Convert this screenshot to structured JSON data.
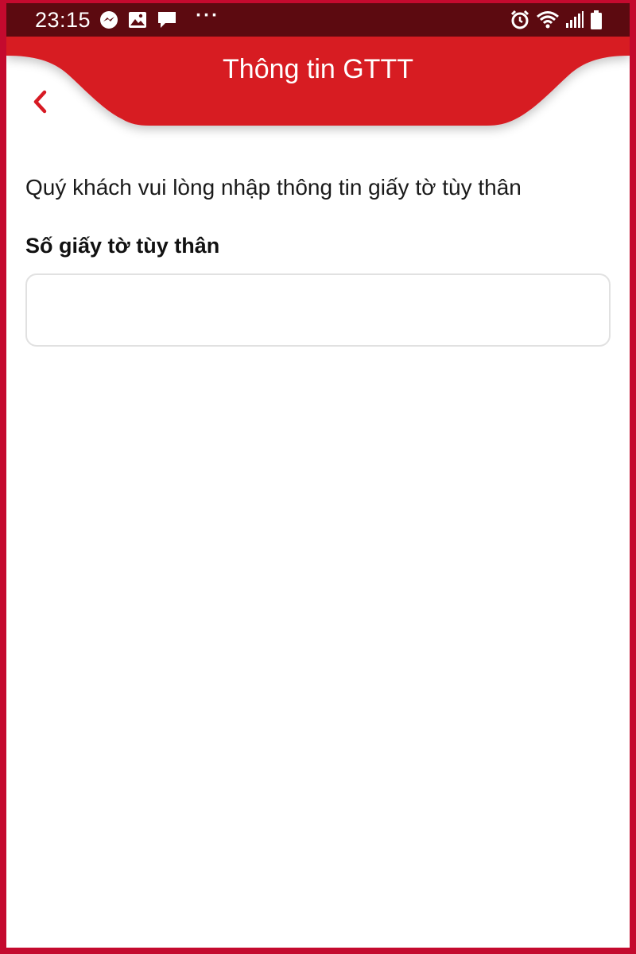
{
  "status_bar": {
    "time": "23:15",
    "left_icons": [
      "messenger-icon",
      "gallery-icon",
      "chat-bubble-icon"
    ],
    "more_indicator": "···",
    "right_icons": [
      "alarm-icon",
      "wifi-icon",
      "signal-icon",
      "battery-icon"
    ]
  },
  "header": {
    "title": "Thông tin GTTT",
    "back_icon": "chevron-left-icon",
    "accent_color": "#d71a24"
  },
  "form": {
    "instruction": "Quý khách vui lòng nhập thông tin giấy tờ tùy thân",
    "id_number_label": "Số giấy tờ tùy thân",
    "id_number_value": ""
  },
  "colors": {
    "frame": "#c40a2e",
    "status_bar": "#5c0a10",
    "header": "#d71a24",
    "input_border": "#e1e1e1"
  }
}
